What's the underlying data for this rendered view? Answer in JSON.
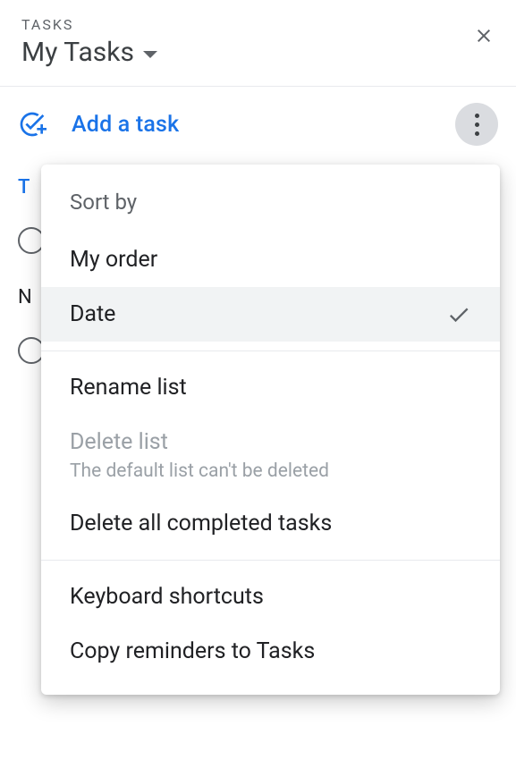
{
  "header": {
    "label": "TASKS",
    "list_title": "My Tasks"
  },
  "toolbar": {
    "add_task_label": "Add a task"
  },
  "background": {
    "section1": "T",
    "section2": "N"
  },
  "menu": {
    "sort_header": "Sort by",
    "sort_options": [
      {
        "label": "My order",
        "selected": false
      },
      {
        "label": "Date",
        "selected": true
      }
    ],
    "rename": "Rename list",
    "delete_list": "Delete list",
    "delete_list_subtext": "The default list can't be deleted",
    "delete_completed": "Delete all completed tasks",
    "keyboard_shortcuts": "Keyboard shortcuts",
    "copy_reminders": "Copy reminders to Tasks"
  }
}
